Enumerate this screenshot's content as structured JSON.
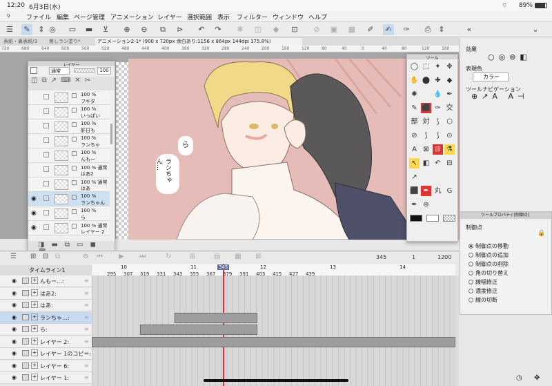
{
  "status_bar": {
    "time": "12:20",
    "date": "6月3日(水)",
    "battery": "89%"
  },
  "menu": [
    "ファイル",
    "編集",
    "ページ管理",
    "アニメーション",
    "レイヤー",
    "選択範囲",
    "表示",
    "フィルター",
    "ウィンドウ",
    "ヘルプ"
  ],
  "tabs": [
    "表紙・裏表紙/3",
    "差しラン塗り*",
    "アニメーション2-1* (900 x 720px 余白あり:1156 x 864px 144dpi 175.8%)"
  ],
  "ruler_ticks": [
    "720",
    "680",
    "640",
    "600",
    "560",
    "520",
    "480",
    "440",
    "400",
    "360",
    "320",
    "280",
    "240",
    "200",
    "160",
    "120",
    "80",
    "40",
    "0",
    "40",
    "80",
    "120",
    "160"
  ],
  "layer_panel": {
    "title": "レイヤー",
    "blend_mode": "通常",
    "opacity": "100",
    "layers": [
      {
        "pct": "100 %",
        "name": "フキダ",
        "selected": false
      },
      {
        "pct": "100 %",
        "name": "いっぱい",
        "selected": false
      },
      {
        "pct": "100 %",
        "name": "肝日も",
        "selected": false
      },
      {
        "pct": "100 %",
        "name": "ランちゃ",
        "selected": false
      },
      {
        "pct": "100 %",
        "name": "んもー",
        "selected": false
      },
      {
        "pct": "100 % 通常",
        "name": "はあ2",
        "selected": false
      },
      {
        "pct": "100 % 通常",
        "name": "はあ",
        "selected": false
      },
      {
        "pct": "100 %",
        "name": "ランちゃん",
        "selected": true
      },
      {
        "pct": "100 %",
        "name": "ら",
        "selected": false
      },
      {
        "pct": "100 % 通常",
        "name": "レイヤー 2",
        "selected": false
      }
    ]
  },
  "speech": {
    "bubble1": "ら",
    "bubble2": "ランちゃん…"
  },
  "tool_panel": {
    "title": "ツール",
    "tools": [
      "lasso",
      "select",
      "move",
      "hand",
      "eyedrop",
      "pen",
      "brush",
      "marker",
      "text",
      "figure",
      "ruler",
      "fill",
      "gradient",
      "eraser"
    ],
    "kanji": [
      "交",
      "部",
      "対",
      "丸",
      "G"
    ]
  },
  "right_panel": {
    "effect_label": "効果",
    "color_label": "表現色",
    "color_value": "カラー",
    "nav_label": "ツールナビゲーション"
  },
  "subtool_panel": {
    "title": "ツールプロパティ[制御点]",
    "section": "制御点",
    "options": [
      {
        "label": "制御点の移動",
        "selected": true
      },
      {
        "label": "制御点の追加",
        "selected": false
      },
      {
        "label": "制御点の削除",
        "selected": false
      },
      {
        "label": "角の切り替え",
        "selected": false
      },
      {
        "label": "線幅修正",
        "selected": false
      },
      {
        "label": "濃度修正",
        "selected": false
      },
      {
        "label": "線の切断",
        "selected": false
      }
    ]
  },
  "timeline": {
    "name": "タイムライン1",
    "current_frame": "345",
    "page": "1",
    "total_frames": "1200",
    "sec_marks": [
      "10",
      "11",
      "12",
      "13",
      "14"
    ],
    "frame_labels": [
      "295",
      "307",
      "319",
      "331",
      "343",
      "355",
      "367",
      "379",
      "391",
      "403",
      "415",
      "427",
      "439"
    ],
    "playhead_label": "345",
    "tracks": [
      {
        "name": "んもー…:",
        "selected": false
      },
      {
        "name": "はあ2:",
        "selected": false
      },
      {
        "name": "はあ:",
        "selected": false
      },
      {
        "name": "ランちゃ…:",
        "selected": true
      },
      {
        "name": "ら:",
        "selected": false
      },
      {
        "name": "レイヤー 2:",
        "selected": false
      },
      {
        "name": "レイヤー 1のコピー:",
        "selected": false
      },
      {
        "name": "レイヤー 6:",
        "selected": false
      },
      {
        "name": "レイヤー 1:",
        "selected": false
      }
    ]
  },
  "colors": {
    "accent": "#2a7bd4",
    "playhead": "#e03030",
    "canvas_pink": "#e6bcb9"
  }
}
